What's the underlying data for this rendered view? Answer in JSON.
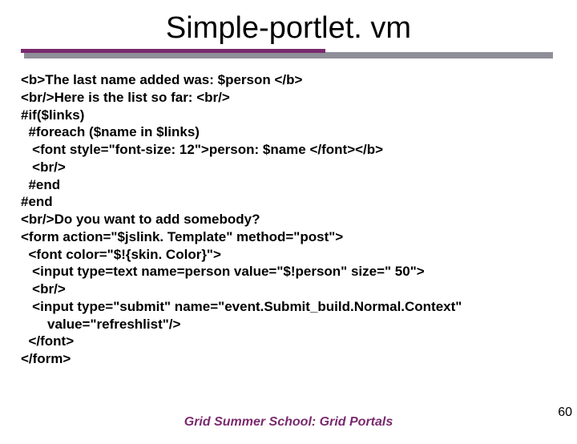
{
  "title": "Simple-portlet. vm",
  "code_lines": [
    "<b>The last name added was: $person </b>",
    "<br/>Here is the list so far: <br/>",
    "#if($links)",
    "  #foreach ($name in $links)",
    "   <font style=\"font-size: 12\">person: $name </font></b>",
    "   <br/>",
    "  #end",
    "#end",
    "<br/>Do you want to add somebody?",
    "<form action=\"$jslink. Template\" method=\"post\">",
    "  <font color=\"$!{skin. Color}\">",
    "   <input type=text name=person value=\"$!person\" size=\" 50\">",
    "   <br/>",
    "   <input type=\"submit\" name=\"event.Submit_build.Normal.Context\"",
    "       value=\"refreshlist\"/>",
    "  </font>",
    "</form>"
  ],
  "footer": "Grid Summer School: Grid Portals",
  "page_number": "60"
}
